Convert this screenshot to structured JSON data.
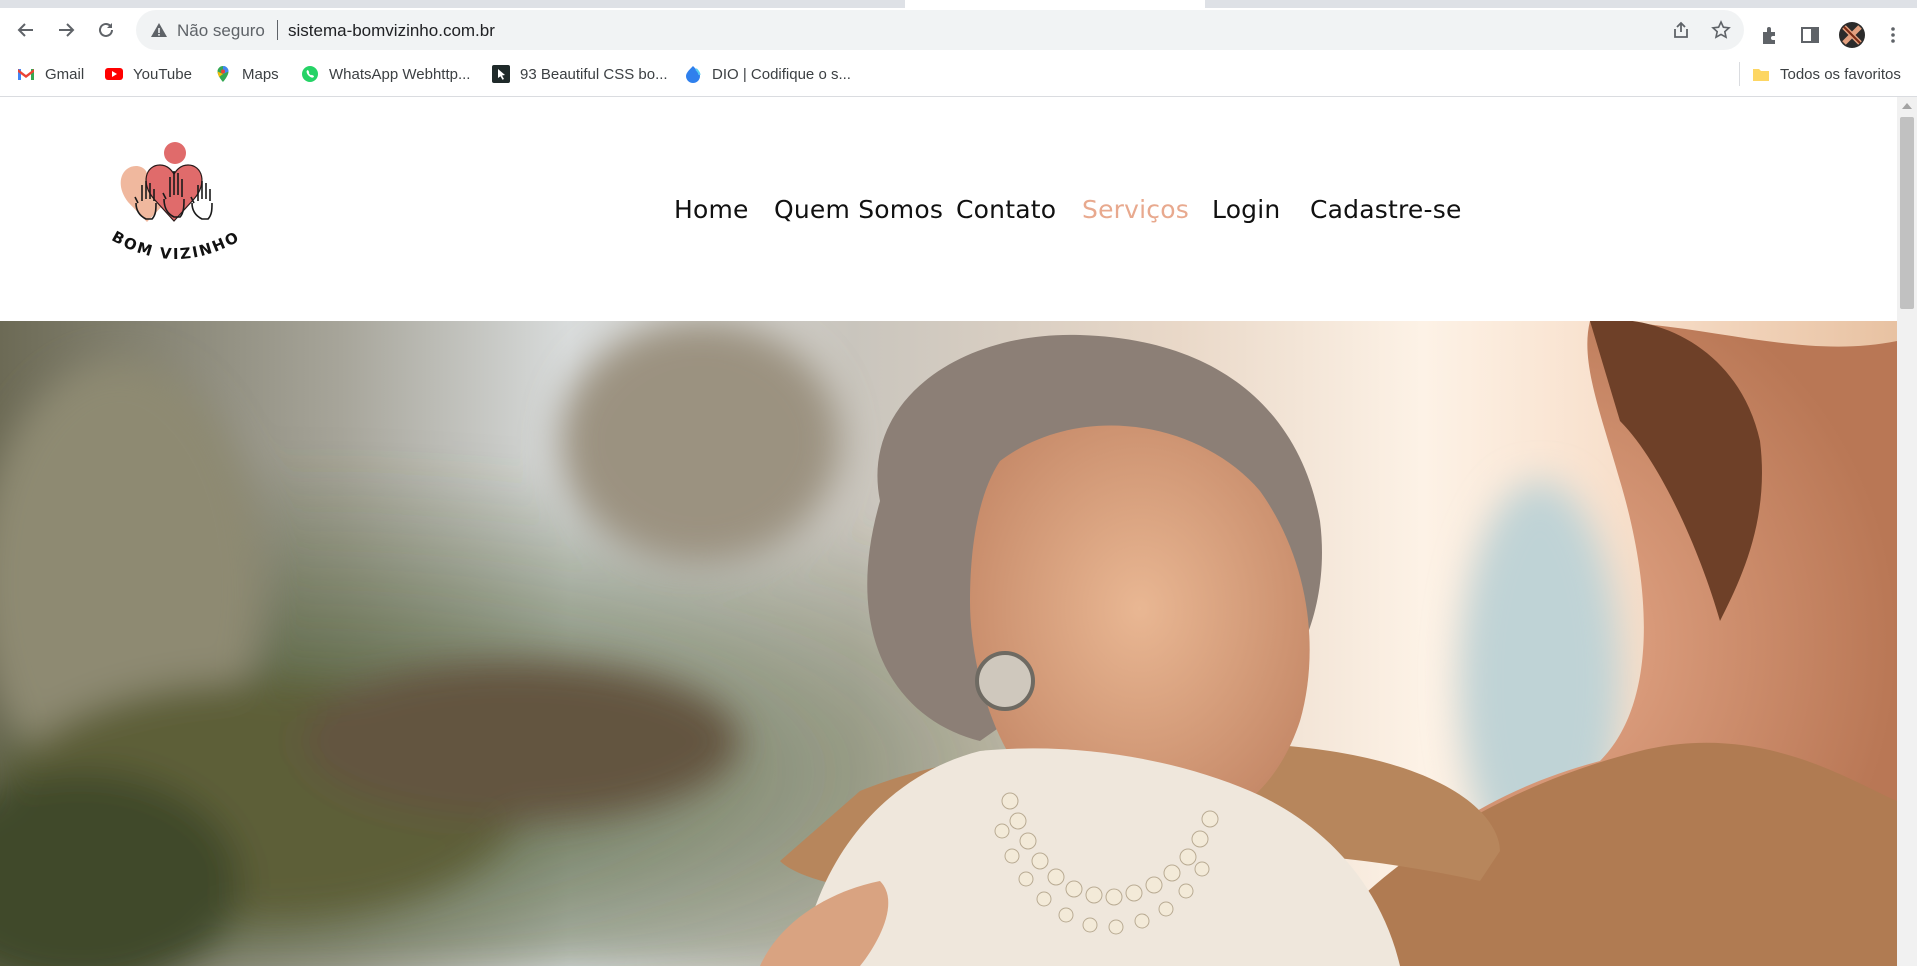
{
  "browser": {
    "security_label": "Não seguro",
    "url": "sistema-bomvizinho.com.br",
    "bookmarks": [
      {
        "label": "Gmail",
        "icon": "gmail-icon"
      },
      {
        "label": "YouTube",
        "icon": "youtube-icon"
      },
      {
        "label": "Maps",
        "icon": "maps-icon"
      },
      {
        "label": "WhatsApp Webhttp...",
        "icon": "whatsapp-icon"
      },
      {
        "label": "93 Beautiful CSS bo...",
        "icon": "cursor-icon"
      },
      {
        "label": "DIO | Codifique o s...",
        "icon": "dio-icon"
      }
    ],
    "all_bookmarks_label": "Todos os favoritos"
  },
  "site": {
    "logo_text": "BOM VIZINHO",
    "nav": [
      {
        "label": "Home",
        "active": false
      },
      {
        "label": "Quem Somos",
        "active": false
      },
      {
        "label": "Contato",
        "active": false
      },
      {
        "label": "Serviços",
        "active": true
      },
      {
        "label": "Login",
        "active": false
      },
      {
        "label": "Cadastre-se",
        "active": false
      }
    ],
    "hero_image": "elderly woman smiling with younger woman outdoors"
  },
  "colors": {
    "nav_text": "#111111",
    "nav_active": "#e8a98e",
    "logo_accent": "#e06b6b",
    "logo_peach": "#eeb093"
  }
}
